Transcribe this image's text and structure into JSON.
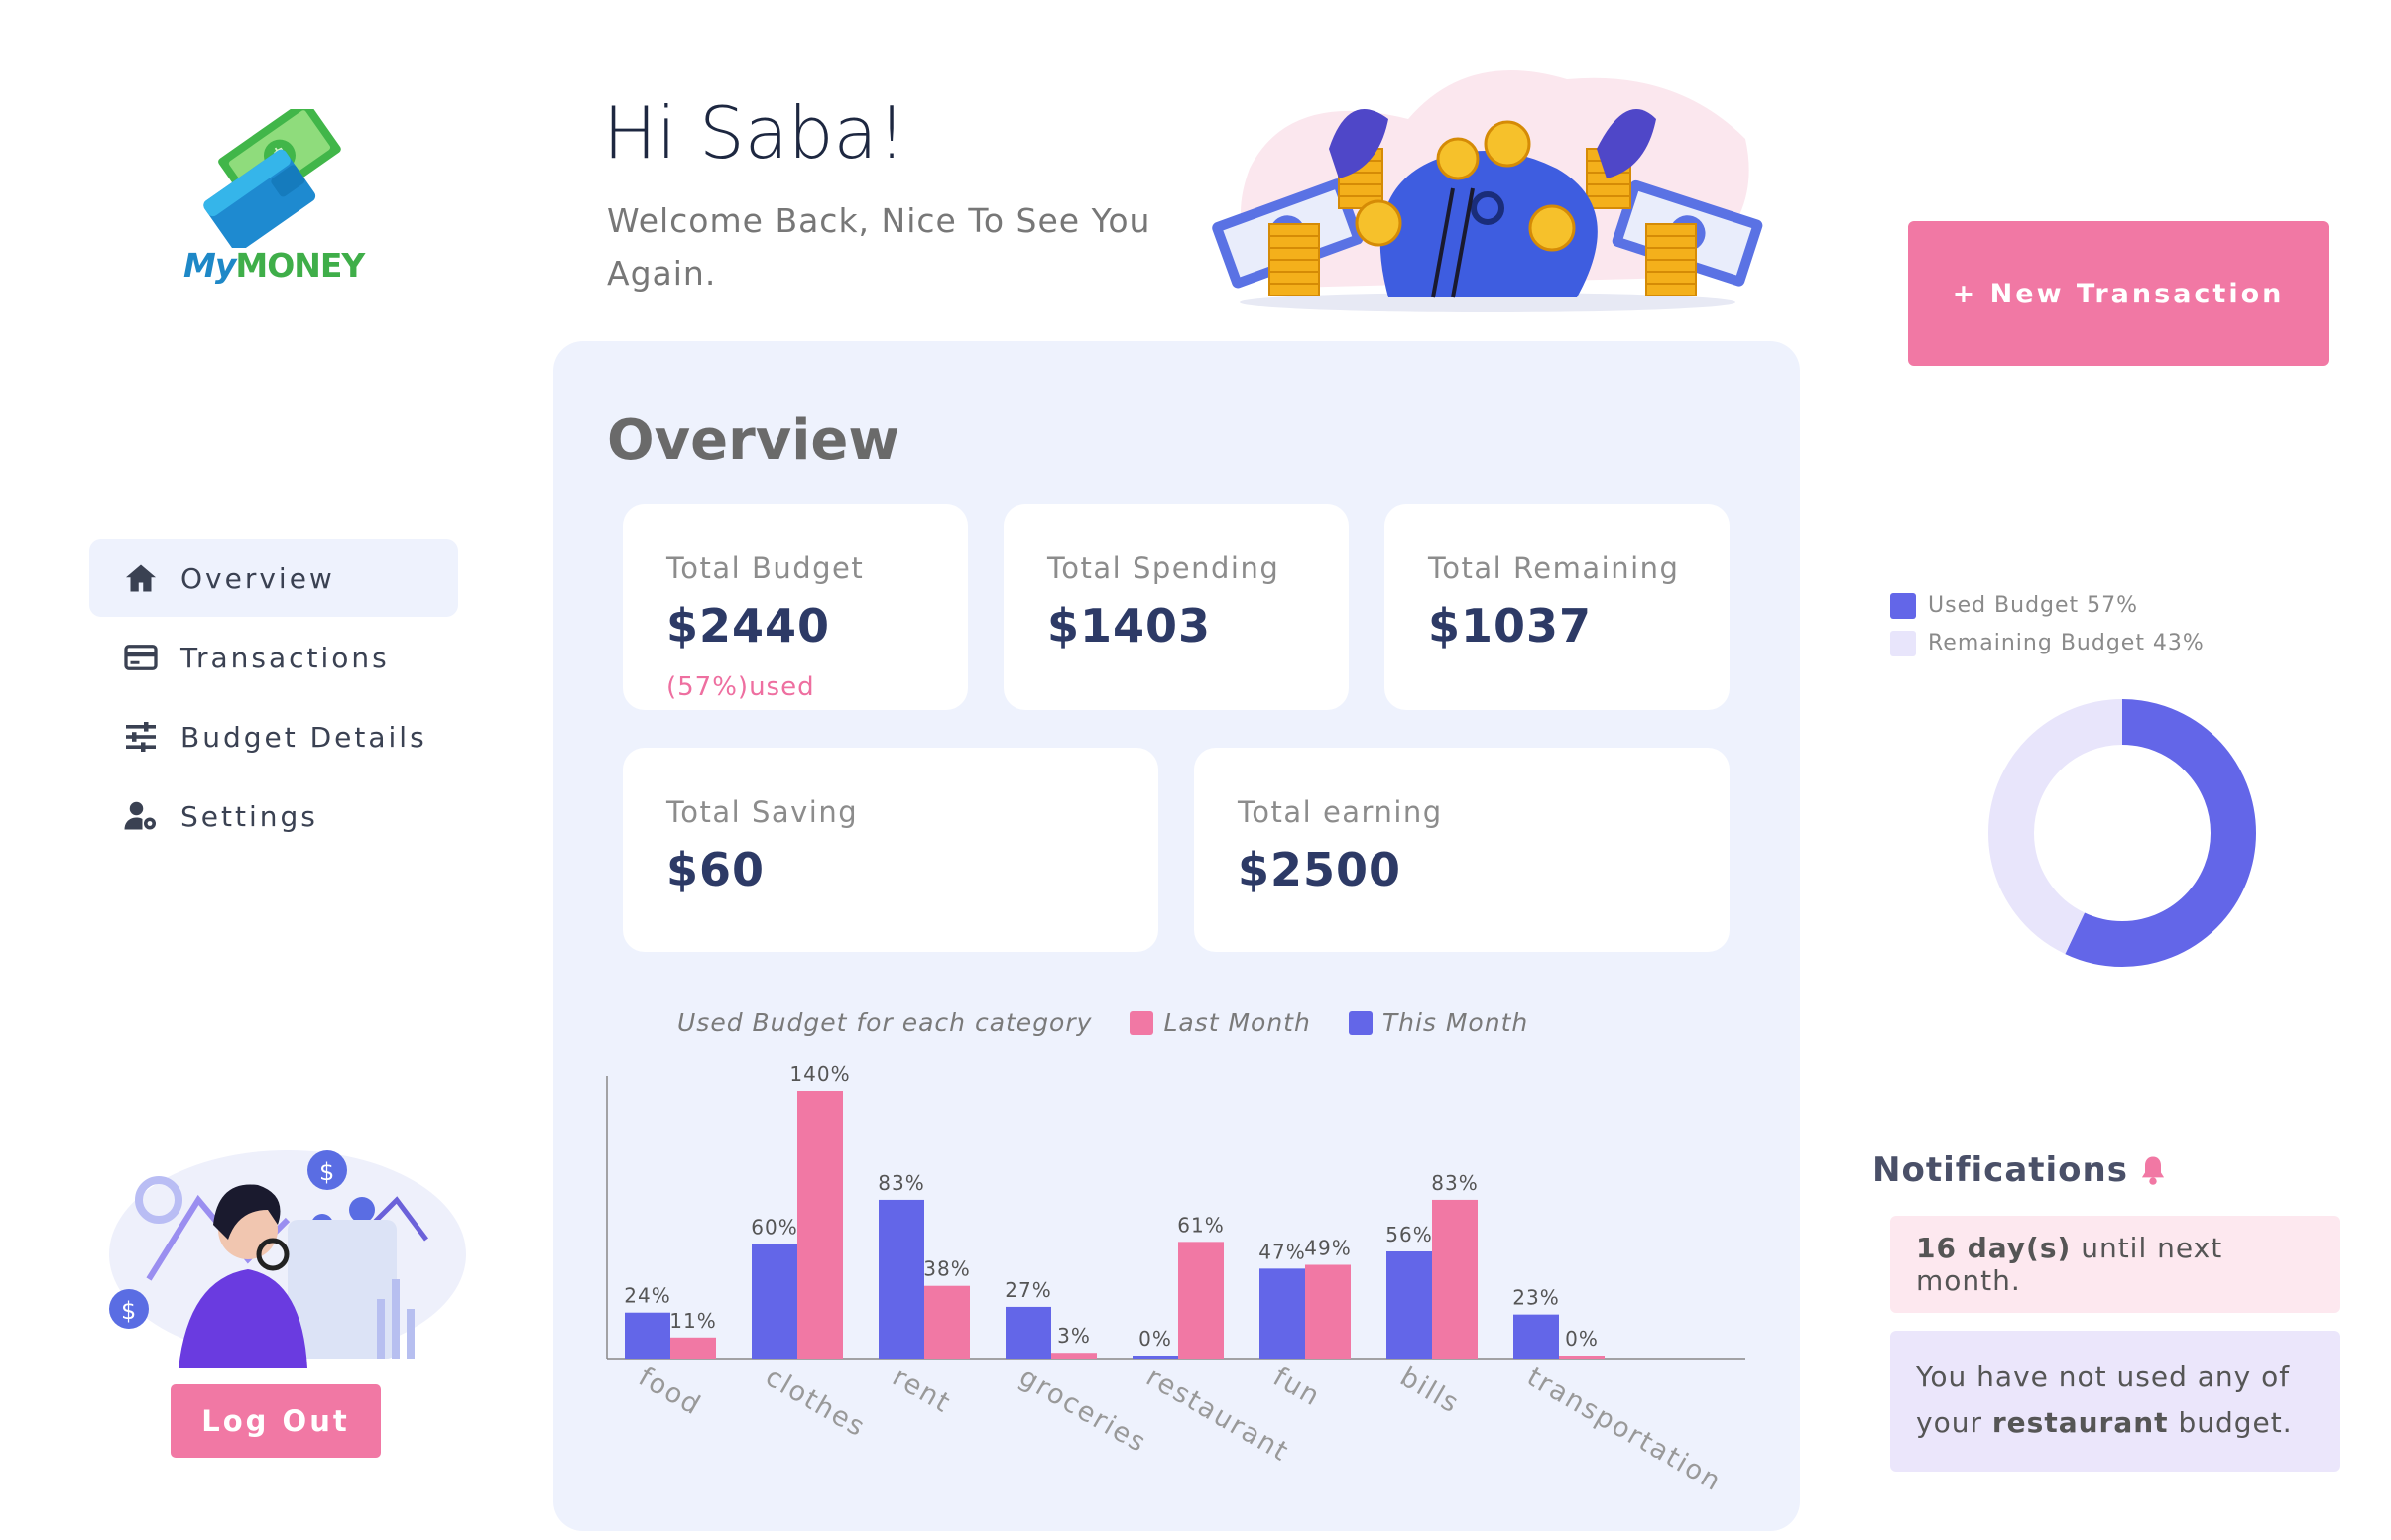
{
  "brand": {
    "my": "My",
    "money": "MONEY"
  },
  "sidebar": {
    "items": [
      {
        "label": "Overview",
        "icon": "home-icon",
        "active": true
      },
      {
        "label": "Transactions",
        "icon": "credit-card-icon",
        "active": false
      },
      {
        "label": "Budget Details",
        "icon": "sliders-icon",
        "active": false
      },
      {
        "label": "Settings",
        "icon": "user-gear-icon",
        "active": false
      }
    ],
    "logout_label": "Log Out"
  },
  "header": {
    "greeting": "Hi Saba!",
    "welcome": "Welcome Back, Nice To See You Again."
  },
  "overview": {
    "title": "Overview",
    "cards": {
      "total_budget": {
        "label": "Total Budget",
        "value": "$2440",
        "sub": "(57%)used"
      },
      "total_spending": {
        "label": "Total Spending",
        "value": "$1403"
      },
      "total_remaining": {
        "label": "Total Remaining",
        "value": "$1037"
      },
      "total_saving": {
        "label": "Total Saving",
        "value": "$60"
      },
      "total_earning": {
        "label": "Total earning",
        "value": "$2500"
      }
    }
  },
  "new_transaction_label": "+ New Transaction",
  "notifications": {
    "title": "Notifications",
    "n1_bold": "16 day(s)",
    "n1_rest": " until next month.",
    "n2_a": "You have not used any of your ",
    "n2_bold": "restaurant",
    "n2_b": " budget."
  },
  "colors": {
    "this_month": "#6366e8",
    "last_month": "#f178a4",
    "remaining": "#e8e5fb",
    "accent": "#f178a4"
  },
  "chart_data": [
    {
      "type": "bar",
      "title": "Used Budget for each category",
      "categories": [
        "food",
        "clothes",
        "rent",
        "groceries",
        "restaurant",
        "fun",
        "bills",
        "transportation"
      ],
      "series": [
        {
          "name": "This Month",
          "color": "#6366e8",
          "values": [
            24,
            60,
            83,
            27,
            0,
            47,
            56,
            23
          ]
        },
        {
          "name": "Last Month",
          "color": "#f178a4",
          "values": [
            11,
            140,
            38,
            3,
            61,
            49,
            83,
            0
          ]
        }
      ],
      "legend_order": [
        "Last Month",
        "This Month"
      ],
      "value_suffix": "%",
      "ylim": [
        0,
        140
      ],
      "legend": "top"
    },
    {
      "type": "pie",
      "style": "donut",
      "labels": [
        "Used Budget",
        "Remaining Budget"
      ],
      "values": [
        57,
        43
      ],
      "legend_labels": [
        "Used Budget 57%",
        "Remaining Budget 43%"
      ],
      "colors": [
        "#6366e8",
        "#e8e5fb"
      ],
      "legend": "top"
    }
  ]
}
